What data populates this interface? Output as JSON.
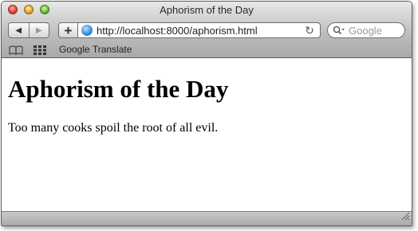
{
  "window": {
    "title": "Aphorism of the Day"
  },
  "toolbar": {
    "back_icon": "triangle-left-icon",
    "forward_icon": "triangle-right-icon",
    "add_icon": "plus-icon",
    "add_label": "+",
    "url": "http://localhost:8000/aphorism.html",
    "reload_icon": "reload-icon",
    "reload_glyph": "↻",
    "search_placeholder": "Google"
  },
  "bookmarks": {
    "items": [
      {
        "label": "Google Translate"
      }
    ]
  },
  "page": {
    "heading": "Aphorism of the Day",
    "paragraph": "Too many cooks spoil the root of all evil."
  },
  "colors": {
    "chrome_top": "#e8e8e8",
    "chrome_bottom": "#a9a9a9",
    "close_light": "#e2463b",
    "minimize_light": "#e8ac2a",
    "zoom_light": "#6cbe35"
  }
}
